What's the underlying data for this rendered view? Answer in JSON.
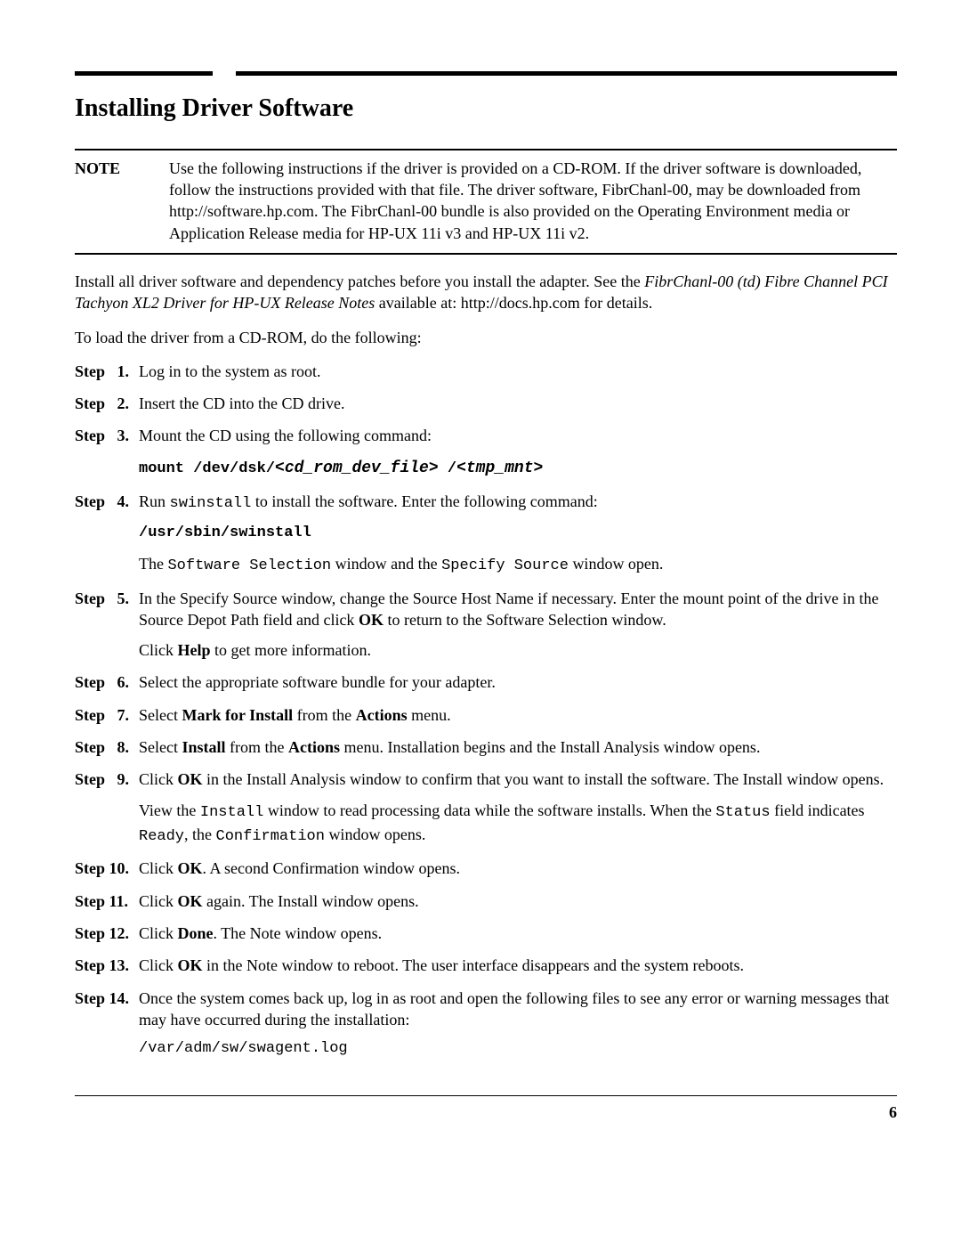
{
  "title": "Installing Driver Software",
  "note": {
    "label": "NOTE",
    "body": "Use the following instructions if the driver is provided on a CD-ROM. If the driver software is downloaded, follow the instructions provided with that file. The driver software, FibrChanl-00, may be downloaded from http://software.hp.com. The FibrChanl-00 bundle is also provided on the Operating Environment media or Application Release media for HP-UX 11i v3  and HP-UX 11i v2."
  },
  "intro1_a": "Install all driver software and dependency patches before you install the adapter. See the ",
  "intro1_b": "FibrChanl-00 (td) Fibre Channel PCI Tachyon XL2 Driver for HP-UX Release Notes",
  "intro1_c": " available at: http://docs.hp.com for details.",
  "intro2": "To load the driver from a CD-ROM, do the following:",
  "step_labels": {
    "s1": "Step   1.",
    "s2": "Step   2.",
    "s3": "Step   3.",
    "s4": "Step   4.",
    "s5": "Step   5.",
    "s6": "Step   6.",
    "s7": "Step   7.",
    "s8": "Step   8.",
    "s9": "Step   9.",
    "s10": "Step 10.",
    "s11": "Step 11.",
    "s12": "Step 12.",
    "s13": "Step 13.",
    "s14": "Step 14."
  },
  "s1": {
    "text": "Log in to the system as root."
  },
  "s2": {
    "text": "Insert the CD into the CD drive."
  },
  "s3": {
    "text": "Mount the CD using the following command:",
    "cmd_a": "mount /dev/dsk/",
    "cmd_b": "<cd_rom_dev_file>",
    "cmd_c": " /",
    "cmd_d": "<tmp_mnt>"
  },
  "s4": {
    "a": "Run ",
    "b": "swinstall",
    "c": " to install the software. Enter the following command:",
    "cmd": "/usr/sbin/swinstall",
    "d": "The ",
    "e": "Software Selection",
    "f": " window and the ",
    "g": "Specify Source",
    "h": " window open."
  },
  "s5": {
    "a": "In the Specify Source window, change the Source Host Name if necessary. Enter the mount point of the drive in the Source Depot Path field and click ",
    "b": "OK",
    "c": " to return to the Software Selection window.",
    "d": "Click ",
    "e": "Help",
    "f": " to get more information."
  },
  "s6": {
    "text": "Select the appropriate software bundle for your adapter."
  },
  "s7": {
    "a": "Select ",
    "b": "Mark for Install",
    "c": " from the ",
    "d": "Actions",
    "e": " menu."
  },
  "s8": {
    "a": "Select ",
    "b": "Install",
    "c": " from the ",
    "d": "Actions",
    "e": " menu. Installation begins and the Install Analysis window opens."
  },
  "s9": {
    "a": "Click ",
    "b": "OK",
    "c": " in the Install Analysis window to confirm that you want to install the software. The Install window opens.",
    "d": "View the ",
    "e": "Install",
    "f": " window to read processing data while the software installs. When the ",
    "g": "Status",
    "h": " field indicates ",
    "i": "Ready",
    "j": ", the ",
    "k": "Confirmation",
    "l": " window opens."
  },
  "s10": {
    "a": "Click ",
    "b": "OK",
    "c": ". A second Confirmation window opens."
  },
  "s11": {
    "a": "Click ",
    "b": "OK",
    "c": " again. The Install window opens."
  },
  "s12": {
    "a": "Click ",
    "b": "Done",
    "c": ". The Note window opens."
  },
  "s13": {
    "a": "Click ",
    "b": "OK",
    "c": " in the Note window to reboot. The user interface disappears and the system reboots."
  },
  "s14": {
    "text": "Once the system comes back up, log in as root and open the following files to see any error or warning messages that may have occurred during the installation:",
    "path": "/var/adm/sw/swagent.log"
  },
  "page_number": "6"
}
